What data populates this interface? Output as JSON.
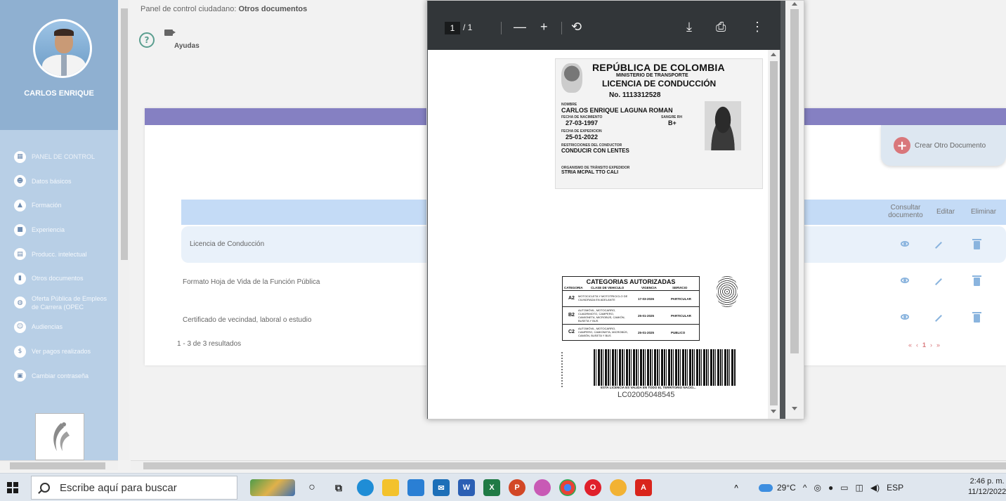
{
  "sidebar": {
    "user_name": "CARLOS ENRIQUE",
    "items": [
      {
        "label": "PANEL DE CONTROL",
        "icon": "dashboard-icon",
        "glyph": "▦"
      },
      {
        "label": "Datos básicos",
        "icon": "people-icon",
        "glyph": "☻"
      },
      {
        "label": "Formación",
        "icon": "graduation-icon",
        "glyph": "▲"
      },
      {
        "label": "Experiencia",
        "icon": "briefcase-icon",
        "glyph": "■"
      },
      {
        "label": "Producc. intelectual",
        "icon": "book-icon",
        "glyph": "▤"
      },
      {
        "label": "Otros documentos",
        "icon": "document-icon",
        "glyph": "▮"
      },
      {
        "label": "Oferta Pública de Empleos de Carrera (OPEC",
        "icon": "globe-icon",
        "glyph": "◍"
      },
      {
        "label": "Audiencias",
        "icon": "audience-icon",
        "glyph": "☺"
      },
      {
        "label": "Ver pagos realizados",
        "icon": "dollar-icon",
        "glyph": "$"
      },
      {
        "label": "Cambiar contraseña",
        "icon": "lock-icon",
        "glyph": "▣"
      }
    ]
  },
  "header": {
    "breadcrumb_prefix": "Panel de control ciudadano:",
    "breadcrumb_current": "Otros documentos",
    "ayudas_label": "Ayudas"
  },
  "card": {
    "create_label": "Crear Otro Documento",
    "columns": {
      "consultar": "Consultar documento",
      "editar": "Editar",
      "eliminar": "Eliminar"
    },
    "rows": [
      {
        "name": "Licencia de Conducción"
      },
      {
        "name": "Formato Hoja de Vida de la Función Pública"
      },
      {
        "name": "Certificado de vecindad, laboral o estudio"
      }
    ],
    "results_text": "1 - 3 de 3 resultados",
    "pager": {
      "first": "«",
      "prev": "‹",
      "current": "1",
      "next": "›",
      "last": "»"
    }
  },
  "pdf": {
    "page_current": "1",
    "page_total": "/ 1",
    "license": {
      "republica": "REPÚBLICA DE COLOMBIA",
      "ministerio": "MINISTERIO DE TRANSPORTE",
      "licencia": "LICENCIA DE CONDUCCIÓN",
      "numero": "No. 1113312528",
      "nombre_label": "NOMBRE",
      "nombre": "CARLOS ENRIQUE LAGUNA ROMAN",
      "fecha_nac_label": "FECHA DE NACIMIENTO",
      "fecha_nac": "27-03-1997",
      "sangre_label": "SANGRE RH",
      "sangre": "B+",
      "fecha_exp_label": "FECHA DE EXPEDICION",
      "fecha_exp": "25-01-2022",
      "restricciones_label": "RESTRICCIONES DEL CONDUCTOR",
      "restricciones": "CONDUCIR CON LENTES",
      "organismo_label": "ORGANISMO DE TRÁNSITO EXPEDIDOR",
      "organismo": "STRIA MCPAL TTO CALI"
    },
    "categories": {
      "title": "CATEGORIAS AUTORIZADAS",
      "headers": [
        "CATEGORIA",
        "CLASE DE VEHICULO",
        "VIGENCIA",
        "SERVICIO"
      ],
      "rows": [
        {
          "cat": "A2",
          "desc": "MOTOCICLETA Y MOTOTRICICLO DE CILINDRADA EN ADELANTE",
          "date": "17-03-2026",
          "serv": "PARTICULAR"
        },
        {
          "cat": "B2",
          "desc": "AUTOMÓVIL, MOTOCARRO, CUADRIMOTO, CAMPERO, CAMIONETA, MICROBÚS, CAMIÓN, BUSETA Y BUS",
          "date": "25-01-2025",
          "serv": "PARTICULAR"
        },
        {
          "cat": "C2",
          "desc": "AUTOMÓVIL, MOTOCARRO, CAMPERO, CAMIONETA, MICROBÚS, CAMIÓN, BUSETA Y BUS",
          "date": "25-01-2025",
          "serv": "PUBLICO"
        }
      ],
      "validity": "ESTA LICENCIA ES VALIDA EN TODO EL TERRITORIO NACIO...",
      "code": "LC02005048545"
    }
  },
  "taskbar": {
    "search_placeholder": "Escribe aquí para buscar",
    "weather": "29°C",
    "language": "ESP",
    "time": "2:46 p. m.",
    "date": "11/12/2022"
  },
  "colors": {
    "accent_purple": "#8580c2",
    "header_blue": "#c4dbf6",
    "sidebar": "#b8cfe6",
    "action_blue": "#8ab4de",
    "pager_red": "#d9777b"
  }
}
